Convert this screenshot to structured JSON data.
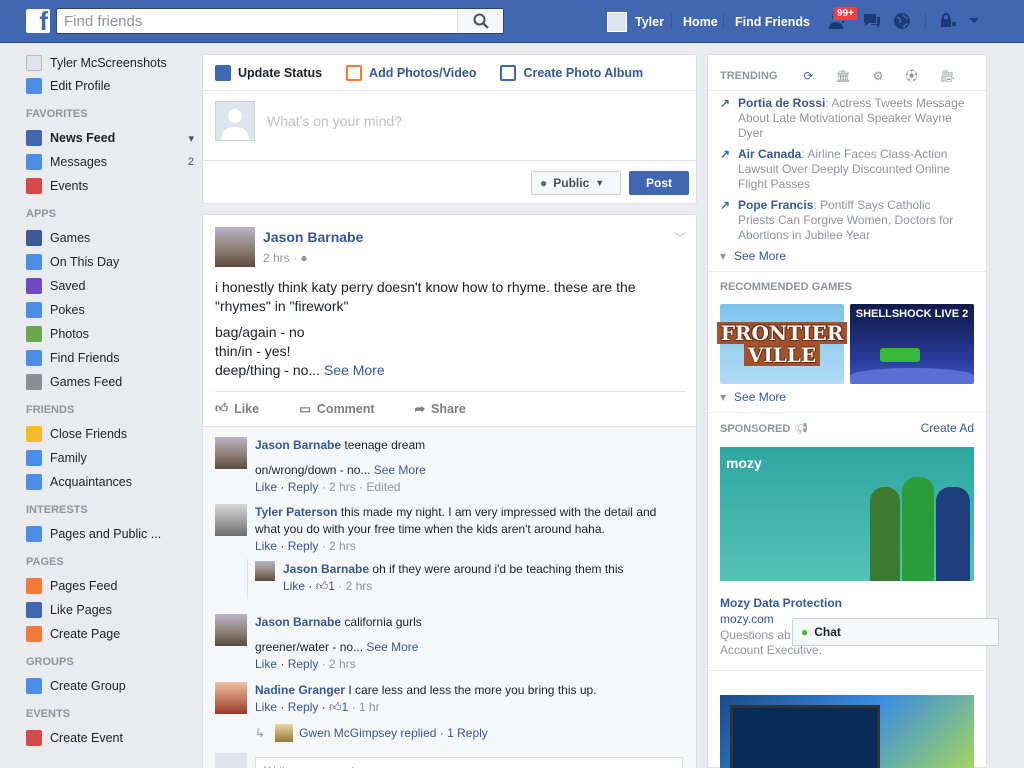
{
  "topbar": {
    "logo": "f",
    "search_placeholder": "Find friends",
    "profile_name": "Tyler",
    "home": "Home",
    "find_friends": "Find Friends",
    "notif_badge": "99+"
  },
  "sidebar": {
    "profile_name": "Tyler McScreenshots",
    "edit_profile": "Edit Profile",
    "sections": [
      {
        "title": "FAVORITES",
        "items": [
          {
            "label": "News Feed",
            "bold": true,
            "color": "#4267b2"
          },
          {
            "label": "Messages",
            "count": "2",
            "color": "#4a8eea"
          },
          {
            "label": "Events",
            "color": "#d94848"
          }
        ]
      },
      {
        "title": "APPS",
        "items": [
          {
            "label": "Games",
            "color": "#3b5998"
          },
          {
            "label": "On This Day",
            "color": "#4a8eea"
          },
          {
            "label": "Saved",
            "color": "#6f4ac7"
          },
          {
            "label": "Pokes",
            "color": "#4a8eea"
          },
          {
            "label": "Photos",
            "color": "#6aa84f"
          },
          {
            "label": "Find Friends",
            "color": "#4a8eea"
          },
          {
            "label": "Games Feed",
            "color": "#8a8d91"
          }
        ]
      },
      {
        "title": "FRIENDS",
        "items": [
          {
            "label": "Close Friends",
            "color": "#f7b928"
          },
          {
            "label": "Family",
            "color": "#4a8eea"
          },
          {
            "label": "Acquaintances",
            "color": "#4a8eea"
          }
        ]
      },
      {
        "title": "INTERESTS",
        "items": [
          {
            "label": "Pages and Public ...",
            "color": "#4a8eea"
          }
        ]
      },
      {
        "title": "PAGES",
        "items": [
          {
            "label": "Pages Feed",
            "color": "#f5793a"
          },
          {
            "label": "Like Pages",
            "color": "#4267b2"
          },
          {
            "label": "Create Page",
            "color": "#f5793a"
          }
        ]
      },
      {
        "title": "GROUPS",
        "items": [
          {
            "label": "Create Group",
            "color": "#4a8eea"
          }
        ]
      },
      {
        "title": "EVENTS",
        "items": [
          {
            "label": "Create Event",
            "color": "#d94848"
          }
        ]
      }
    ]
  },
  "composer": {
    "tabs": [
      "Update Status",
      "Add Photos/Video",
      "Create Photo Album"
    ],
    "placeholder": "What's on your mind?",
    "audience": "Public",
    "post": "Post"
  },
  "post": {
    "author": "Jason Barnabe",
    "time": "2 hrs",
    "text1": "i honestly think katy perry doesn't know how to rhyme. these are the \"rhymes\" in \"firework\"",
    "line1": "bag/again - no",
    "line2": "thin/in - yes!",
    "line3": "deep/thing - no...",
    "see_more": "See More",
    "like": "Like",
    "comment": "Comment",
    "share": "Share"
  },
  "comments": [
    {
      "author": "Jason Barnabe",
      "text": "teenage dream",
      "text2": "on/wrong/down - no...",
      "see_more": "See More",
      "like": "Like",
      "reply": "Reply",
      "meta": "· 2 hrs · Edited"
    },
    {
      "author": "Tyler Paterson",
      "text": "this made my night. I am very impressed with the detail and what you do with your free time when the kids aren't around haha.",
      "like": "Like",
      "reply": "Reply",
      "meta": "· 2 hrs"
    },
    {
      "author": "Jason Barnabe",
      "text": "oh if they were around i'd be teaching them this",
      "like": "Like",
      "likes": "1",
      "meta": "· 2 hrs"
    },
    {
      "author": "Jason Barnabe",
      "text": "california gurls",
      "text2": "greener/water - no...",
      "see_more": "See More",
      "like": "Like",
      "reply": "Reply",
      "meta": "· 2 hrs"
    },
    {
      "author": "Nadine Granger",
      "text": "I care less and less the more you bring this up.",
      "like": "Like",
      "reply": "Reply",
      "likes": "1",
      "meta": "· 1 hr"
    }
  ],
  "reply_summary": "Gwen McGimpsey replied · 1 Reply",
  "write_comment": "Write a comment...",
  "trending": {
    "title": "TRENDING",
    "items": [
      {
        "topic": "Portia de Rossi",
        "desc": ": Actress Tweets Message About Late Motivational Speaker Wayne Dyer"
      },
      {
        "topic": "Air Canada",
        "desc": ": Airline Faces Class-Action Lawsuit Over Deeply Discounted Online Flight Passes"
      },
      {
        "topic": "Pope Francis",
        "desc": ": Pontiff Says Catholic Priests Can Forgive Women, Doctors for Abortions in Jubilee Year"
      }
    ],
    "see_more": "See More"
  },
  "games": {
    "title": "RECOMMENDED GAMES",
    "game1_line1": "FRONTIER",
    "game1_line2": "VILLE",
    "game2": "SHELLSHOCK LIVE 2",
    "see_more": "See More"
  },
  "sponsored": {
    "title": "SPONSORED",
    "create_ad": "Create Ad",
    "brand": "mozy",
    "ad_title": "Mozy Data Protection",
    "ad_url": "mozy.com",
    "ad_text1": "Questions ab",
    "ad_text2": "Account Executive."
  },
  "chat": {
    "label": "Chat"
  }
}
